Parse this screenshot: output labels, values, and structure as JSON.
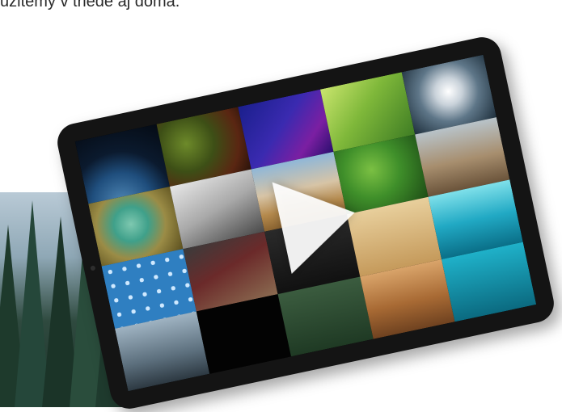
{
  "caption": "užitemy v triede aj doma.",
  "tiles": [
    {
      "name": "earth-tile",
      "class": "t-earth"
    },
    {
      "name": "plants-tile",
      "class": "t-plants"
    },
    {
      "name": "thermal-image-tile",
      "class": "t-thermal"
    },
    {
      "name": "leaf-tile",
      "class": "t-leaf"
    },
    {
      "name": "hurricane-tile",
      "class": "t-hurricane"
    },
    {
      "name": "cell-tile",
      "class": "t-cell"
    },
    {
      "name": "historic-photo-tile",
      "class": "t-historic"
    },
    {
      "name": "pyramids-tile",
      "class": "t-pyramids"
    },
    {
      "name": "moss-tile",
      "class": "t-moss"
    },
    {
      "name": "animal-tile",
      "class": "t-animal"
    },
    {
      "name": "honeycomb-pattern-tile",
      "class": "t-honeycomb"
    },
    {
      "name": "people-tile",
      "class": "t-people"
    },
    {
      "name": "dark-tile",
      "class": "t-dark"
    },
    {
      "name": "sand-tile",
      "class": "t-sand"
    },
    {
      "name": "sea-water-tile",
      "class": "t-sea"
    },
    {
      "name": "ship-tile",
      "class": "t-ship"
    },
    {
      "name": "moon-tile",
      "class": "t-moon"
    },
    {
      "name": "forest-tile",
      "class": "t-forest2"
    },
    {
      "name": "mars-rover-tile",
      "class": "t-rover"
    },
    {
      "name": "water-tile",
      "class": "t-water2"
    }
  ],
  "icons": {
    "play": "play-icon"
  }
}
